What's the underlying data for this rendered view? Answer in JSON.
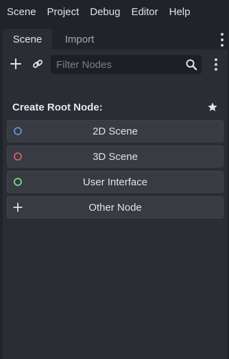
{
  "menubar": {
    "items": [
      "Scene",
      "Project",
      "Debug",
      "Editor",
      "Help"
    ]
  },
  "dock": {
    "tabs": [
      {
        "label": "Scene",
        "active": true
      },
      {
        "label": "Import",
        "active": false
      }
    ]
  },
  "toolbar": {
    "add_icon": "plus-icon",
    "link_icon": "link-icon",
    "filter": {
      "placeholder": "Filter Nodes",
      "value": ""
    },
    "search_icon": "search-icon",
    "more_icon": "kebab-menu-icon"
  },
  "create_root": {
    "heading": "Create Root Node:",
    "favorite_icon": "star-icon",
    "buttons": [
      {
        "label": "2D Scene",
        "icon": "circle-outline-icon",
        "color": "#6b8fdc"
      },
      {
        "label": "3D Scene",
        "icon": "circle-outline-icon",
        "color": "#e05b6b"
      },
      {
        "label": "User Interface",
        "icon": "circle-outline-icon",
        "color": "#7bd97f"
      },
      {
        "label": "Other Node",
        "icon": "plus-icon",
        "color": "#dfe2e6"
      }
    ]
  }
}
